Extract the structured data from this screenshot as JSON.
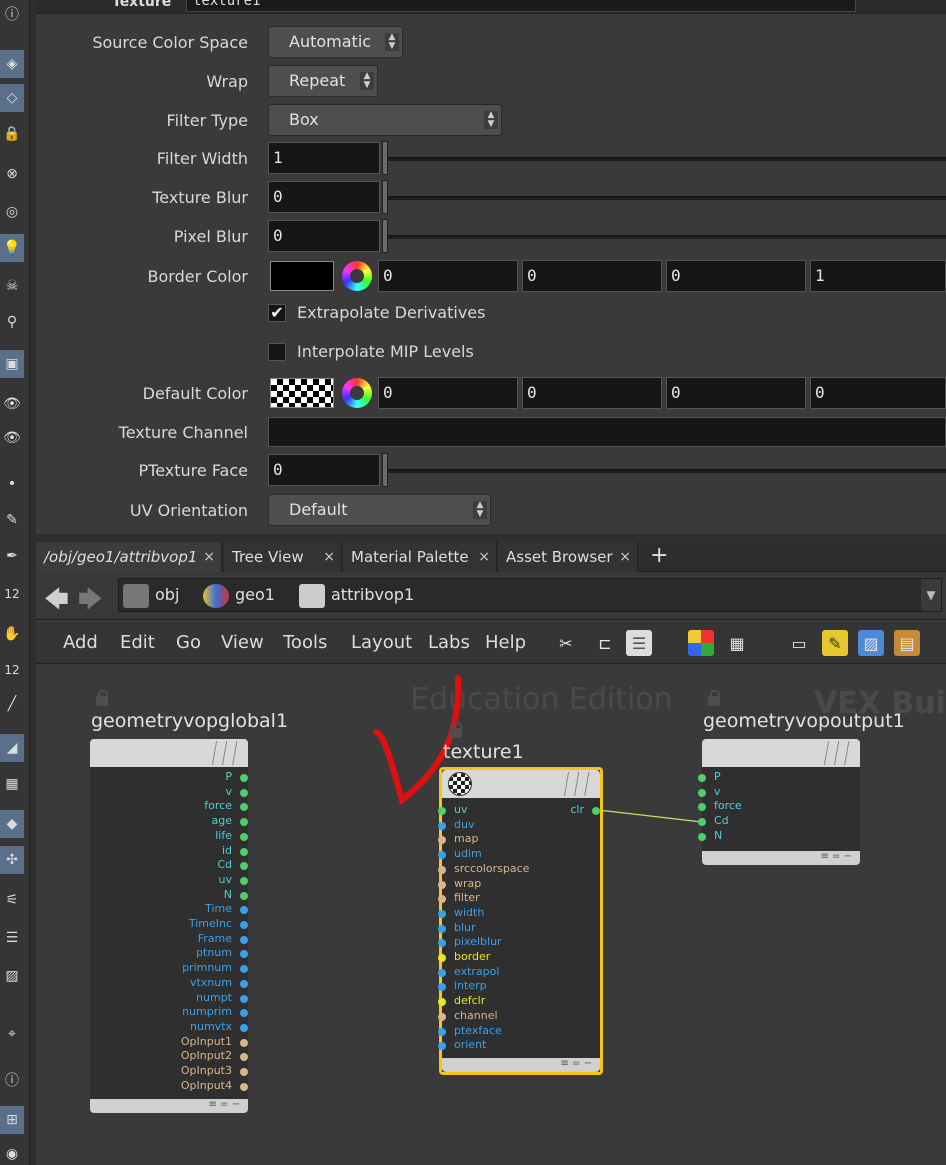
{
  "top": {
    "node_type": "Texture",
    "node_name": "texture1"
  },
  "params": {
    "source_color_space": {
      "label": "Source Color Space",
      "value": "Automatic"
    },
    "wrap": {
      "label": "Wrap",
      "value": "Repeat"
    },
    "filter_type": {
      "label": "Filter Type",
      "value": "Box"
    },
    "filter_width": {
      "label": "Filter Width",
      "value": "1"
    },
    "texture_blur": {
      "label": "Texture Blur",
      "value": "0"
    },
    "pixel_blur": {
      "label": "Pixel Blur",
      "value": "0"
    },
    "border_color": {
      "label": "Border Color",
      "values": [
        "0",
        "0",
        "0",
        "1"
      ]
    },
    "extrapolate": {
      "label": "Extrapolate Derivatives",
      "checked": true
    },
    "interpolate_mip": {
      "label": "Interpolate MIP Levels",
      "checked": false
    },
    "default_color": {
      "label": "Default Color",
      "values": [
        "0",
        "0",
        "0",
        "0"
      ]
    },
    "texture_channel": {
      "label": "Texture Channel",
      "value": ""
    },
    "ptexture_face": {
      "label": "PTexture Face",
      "value": "0"
    },
    "uv_orientation": {
      "label": "UV Orientation",
      "value": "Default"
    }
  },
  "tabs": [
    {
      "label": "/obj/geo1/attribvop1",
      "close": "×"
    },
    {
      "label": "Tree View",
      "close": "×"
    },
    {
      "label": "Material Palette",
      "close": "×"
    },
    {
      "label": "Asset Browser",
      "close": "×"
    }
  ],
  "tab_add": "+",
  "path": {
    "back": "🡄",
    "forward": "🡆",
    "crumbs": [
      "obj",
      "geo1",
      "attribvop1"
    ],
    "drop": "▼"
  },
  "menubar": {
    "items": [
      "Add",
      "Edit",
      "Go",
      "View",
      "Tools",
      "Layout",
      "Labs",
      "Help"
    ]
  },
  "network": {
    "watermark_left": "Education Edition",
    "watermark_right": "VEX Buil",
    "global_node": {
      "title": "geometryvopglobal1",
      "outputs": [
        "P",
        "v",
        "force",
        "age",
        "life",
        "id",
        "Cd",
        "uv",
        "N",
        "Time",
        "TimeInc",
        "Frame",
        "ptnum",
        "primnum",
        "vtxnum",
        "numpt",
        "numprim",
        "numvtx",
        "OpInput1",
        "OpInput2",
        "OpInput3",
        "OpInput4"
      ]
    },
    "texture_node": {
      "title": "texture1",
      "inputs": [
        "uv",
        "duv",
        "map",
        "udim",
        "srccolorspace",
        "wrap",
        "filter",
        "width",
        "blur",
        "pixelblur",
        "border",
        "extrapol",
        "interp",
        "defclr",
        "channel",
        "ptexface",
        "orient"
      ],
      "output": "clr"
    },
    "output_node": {
      "title": "geometryvopoutput1",
      "inputs": [
        "P",
        "v",
        "force",
        "Cd",
        "N"
      ]
    },
    "foot_glyphs": "≡ = −"
  },
  "colors": {
    "selected_node_border": "#f5c518",
    "wire": "#c8e06a",
    "annotation_red": "#e01010",
    "port_green": "#4fcf6a",
    "port_blue": "#3aa0e8",
    "port_tan": "#d8b68a",
    "port_yellow": "#e8e820",
    "port_cyan": "#4fd0d0"
  }
}
